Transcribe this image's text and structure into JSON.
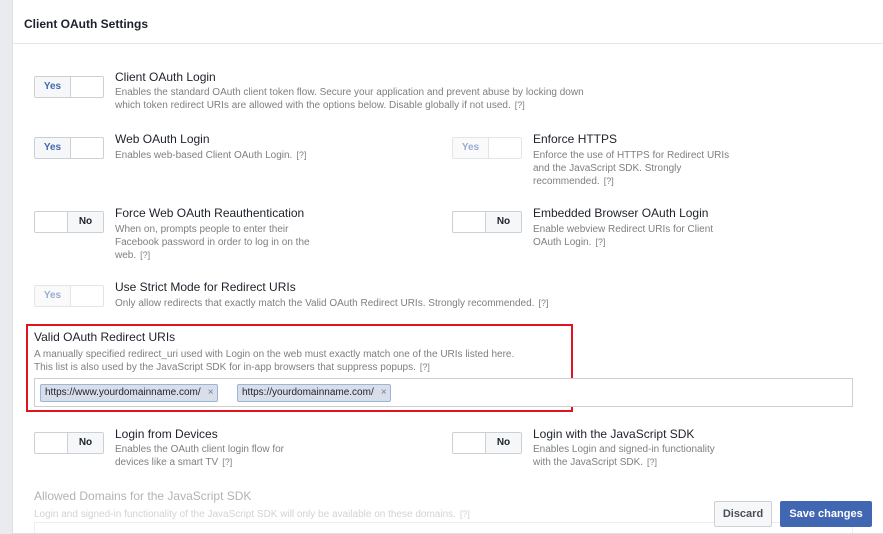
{
  "panel": {
    "title": "Client OAuth Settings"
  },
  "help_label": "[?]",
  "options": {
    "client_oauth_login": {
      "state": "Yes",
      "title": "Client OAuth Login",
      "desc1": "Enables the standard OAuth client token flow. Secure your application and prevent abuse by locking down",
      "desc2": "which token redirect URIs are allowed with the options below. Disable globally if not used."
    },
    "web_oauth_login": {
      "state": "Yes",
      "title": "Web OAuth Login",
      "desc1": "Enables web-based Client OAuth Login."
    },
    "enforce_https": {
      "state": "Yes",
      "title": "Enforce HTTPS",
      "desc1": "Enforce the use of HTTPS for Redirect URIs",
      "desc2": "and the JavaScript SDK. Strongly",
      "desc3": "recommended."
    },
    "force_reauth": {
      "state": "No",
      "title": "Force Web OAuth Reauthentication",
      "desc1": "When on, prompts people to enter their",
      "desc2": "Facebook password in order to log in on the",
      "desc3": "web."
    },
    "embedded_browser": {
      "state": "No",
      "title": "Embedded Browser OAuth Login",
      "desc1": "Enable webview Redirect URIs for Client",
      "desc2": "OAuth Login."
    },
    "strict_mode": {
      "state": "Yes",
      "title": "Use Strict Mode for Redirect URIs",
      "desc1": "Only allow redirects that exactly match the Valid OAuth Redirect URIs. Strongly recommended."
    },
    "login_from_devices": {
      "state": "No",
      "title": "Login from Devices",
      "desc1": "Enables the OAuth client login flow for",
      "desc2": "devices like a smart TV"
    },
    "login_js_sdk": {
      "state": "No",
      "title": "Login with the JavaScript SDK",
      "desc1": "Enables Login and signed-in functionality",
      "desc2": "with the JavaScript SDK."
    }
  },
  "redirect_uris": {
    "title": "Valid OAuth Redirect URIs",
    "desc1": "A manually specified redirect_uri used with Login on the web must exactly match one of the URIs listed here.",
    "desc2": "This list is also used by the JavaScript SDK for in-app browsers that suppress popups.",
    "tags": [
      "https://www.yourdomainname.com/",
      "https://yourdomainname.com/"
    ],
    "remove_glyph": "×"
  },
  "allowed_domains": {
    "title": "Allowed Domains for the JavaScript SDK",
    "desc1": "Login and signed-in functionality of the JavaScript SDK will only be available on these domains."
  },
  "footer": {
    "discard_label": "Discard",
    "save_label": "Save changes"
  },
  "colors": {
    "accent": "#4267b2",
    "highlight_border": "#e0141e"
  }
}
